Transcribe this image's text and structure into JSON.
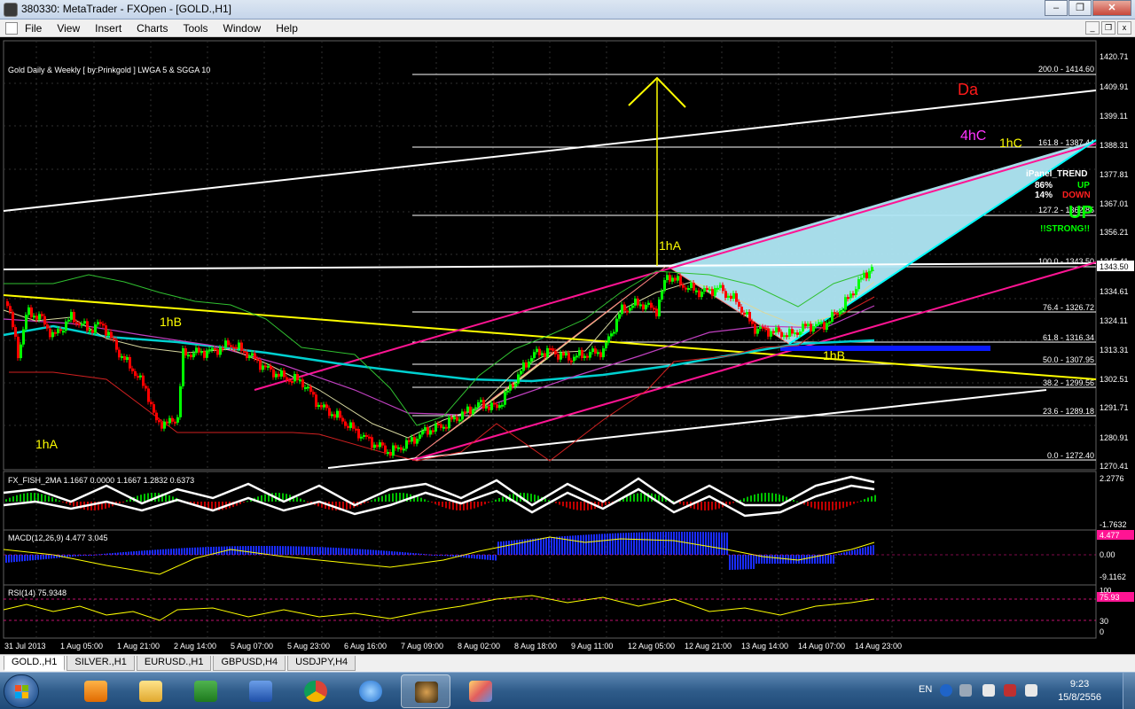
{
  "window": {
    "title": "380330: MetaTrader - FXOpen - [GOLD.,H1]",
    "buttons": [
      "–",
      "❐",
      "✕"
    ]
  },
  "menu": [
    "File",
    "View",
    "Insert",
    "Charts",
    "Tools",
    "Window",
    "Help"
  ],
  "chart": {
    "header": "Gold Daily & Weekly [ by:Prinkgold ]  LWGA 5  &  SGGA 10",
    "current_price": "1343.50",
    "price_scale": [
      "1420.71",
      "1409.91",
      "1399.11",
      "1388.31",
      "1377.81",
      "1367.01",
      "1356.21",
      "1345.41",
      "1334.61",
      "1324.11",
      "1313.31",
      "1302.51",
      "1291.71",
      "1280.91",
      "1270.41"
    ],
    "fib_levels": [
      "200.0 - 1414.60",
      "161.8 - 1387.44",
      "127.2 - 1362.85",
      "100.0 - 1343.50",
      "76.4 - 1326.72",
      "61.8 - 1316.34",
      "50.0 - 1307.95",
      "38.2 - 1299.56",
      "23.6 - 1289.18",
      "0.0 - 1272.40"
    ],
    "time_axis": [
      "31 Jul 2013",
      "1 Aug 05:00",
      "1 Aug 21:00",
      "2 Aug 14:00",
      "5 Aug 07:00",
      "5 Aug 23:00",
      "6 Aug 16:00",
      "7 Aug 09:00",
      "8 Aug 02:00",
      "8 Aug 18:00",
      "9 Aug 11:00",
      "12 Aug 05:00",
      "12 Aug 21:00",
      "13 Aug 14:00",
      "14 Aug 07:00",
      "14 Aug 23:00"
    ],
    "annotations": {
      "da": "Da",
      "c4h": "4hC",
      "c1h": "1hC",
      "a1h_top": "1hA",
      "b1h_left": "1hB",
      "b1h_right": "1hB",
      "a1h_bottom": "1hA"
    },
    "ipanel": {
      "title": "iPanel_TREND",
      "up_pct": "86%",
      "up_label": "UP",
      "down_pct": "14%",
      "down_label": "DOWN",
      "signal": "UP",
      "strength": "!!STRONG!!"
    },
    "colors": {
      "up_candle": "#00ff00",
      "down_candle": "#ff0000",
      "pink_line": "#ff1493",
      "yellow": "#ffff00",
      "triangle_fill": "#b0e8f5",
      "cyan_ma": "#00e0e0"
    }
  },
  "indicators": {
    "fish": {
      "label": "FX_FISH_2MA 1.1667 0.0000 1.1667 1.2832 0.6373",
      "scale": [
        "2.2776",
        "-1.7632"
      ]
    },
    "macd": {
      "label": "MACD(12,26,9) 4.477 3.045",
      "scale": [
        "4.477",
        "0.00",
        "-9.1162"
      ]
    },
    "rsi": {
      "label": "RSI(14) 75.9348",
      "scale": [
        "100",
        "75.93",
        "30",
        "0"
      ]
    }
  },
  "tabs": [
    "GOLD.,H1",
    "SILVER.,H1",
    "EURUSD.,H1",
    "GBPUSD,H4",
    "USDJPY,H4"
  ],
  "taskbar": {
    "lang": "EN",
    "time": "9:23",
    "date": "15/8/2556"
  }
}
